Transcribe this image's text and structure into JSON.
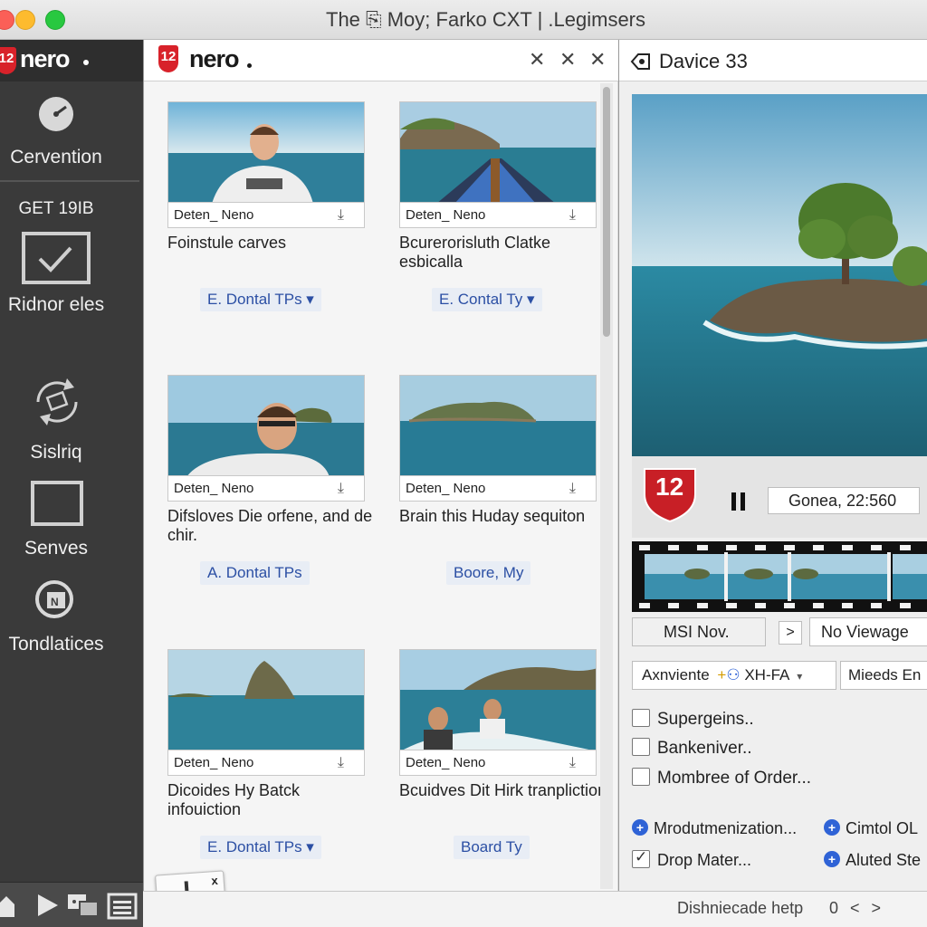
{
  "window": {
    "title": "The ⎘ Moy; Farko CXT | .Legimsers"
  },
  "sidebar": {
    "logo_badge": "12",
    "logo_text": "nero",
    "items": [
      {
        "label": "Cervention",
        "icon": "gauge-icon"
      },
      {
        "label": "GET 19IB",
        "icon": ""
      },
      {
        "label": "Ridnor eles",
        "icon": "checkbox-icon"
      },
      {
        "label": "Sislriq",
        "icon": "sync-icon"
      },
      {
        "label": "Senves",
        "icon": "window-icon"
      },
      {
        "label": "Tondlatices",
        "icon": "disc-icon"
      }
    ],
    "toolbar": [
      "home-icon",
      "play-icon",
      "transfer-icon",
      "calendar-icon"
    ]
  },
  "middle": {
    "logo_badge": "12",
    "logo_text": "nero",
    "header_controls": [
      "✕",
      "✕",
      "✕"
    ],
    "cards": [
      {
        "bar": "Deten_ Neno",
        "title": "Foinstule carves",
        "chip": "E. Dontal TPs ▾"
      },
      {
        "bar": "Deten_ Neno",
        "title": "Bcurerorisluth Clatke esbicalla",
        "chip": "E. Contal Ty ▾"
      },
      {
        "bar": "Deten_ Neno",
        "title": "Difsloves Die orfene, and de chir.",
        "chip": "A. Dontal TPs"
      },
      {
        "bar": "Deten_ Neno",
        "title": "Brain this Huday sequiton",
        "chip": "Boore, My"
      },
      {
        "bar": "Deten_ Neno",
        "title": "Dicoides Hy Batck infouiction",
        "chip": "E. Dontal TPs ▾"
      },
      {
        "bar": "Deten_ Neno",
        "title": "Bcuidves Dit Hirk tranpliction",
        "chip": "Board Ty"
      }
    ],
    "drag_badge": {
      "top": "x",
      "left": "13",
      "bottom": "23"
    }
  },
  "right": {
    "header_title": "Davice 33",
    "badge": "12",
    "timecode": "Gonea, 22:560",
    "buttons_row1": {
      "left": "MSI Nov.",
      "mid": ">",
      "right": "No Viewage"
    },
    "dropdown_row": {
      "left": "Axnviente",
      "left_icon": "+",
      "mid": "XH-FA",
      "right": "Mieeds En"
    },
    "checks": [
      {
        "label": "Supergeins..",
        "checked": false
      },
      {
        "label": "Bankeniver..",
        "checked": false
      },
      {
        "label": "Mombree of Order...",
        "checked": false
      }
    ],
    "radios": [
      {
        "label": "Mrodutmenization...",
        "label2": "Cimtol OL"
      },
      {
        "label": "Drop Mater...",
        "label2": "Aluted Ste",
        "checked": true
      }
    ]
  },
  "statusbar": {
    "text": "Dishniecade hetp",
    "controls": "0 < >"
  }
}
